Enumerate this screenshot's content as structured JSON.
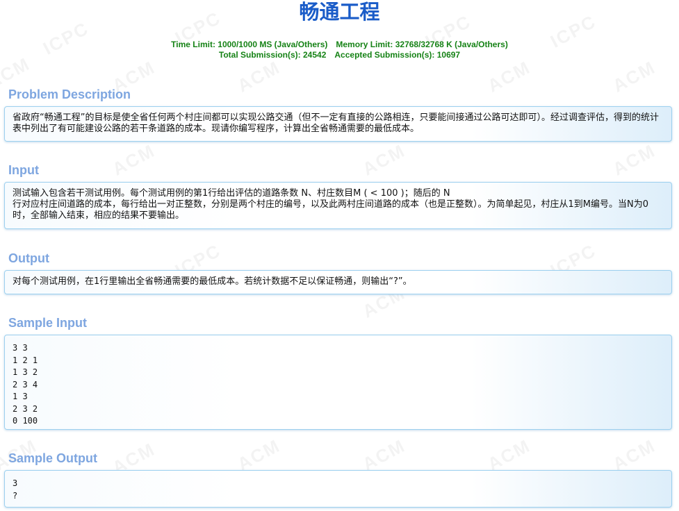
{
  "problem": {
    "title": "畅通工程",
    "time_limit": "Time Limit: 1000/1000 MS (Java/Others)",
    "memory_limit": "Memory Limit: 32768/32768 K (Java/Others)",
    "total_submissions": "Total Submission(s): 24542",
    "accepted_submissions": "Accepted Submission(s): 10697"
  },
  "sections": {
    "description": {
      "heading": "Problem Description",
      "text": "省政府“畅通工程”的目标是使全省任何两个村庄间都可以实现公路交通（但不一定有直接的公路相连，只要能间接通过公路可达即可）。经过调查评估，得到的统计表中列出了有可能建设公路的若干条道路的成本。现请你编写程序，计算出全省畅通需要的最低成本。"
    },
    "input": {
      "heading": "Input",
      "text_line1": "测试输入包含若干测试用例。每个测试用例的第1行给出评估的道路条数 N、村庄数目M ( < 100 )；随后的 N",
      "text_line2": "行对应村庄间道路的成本，每行给出一对正整数，分别是两个村庄的编号，以及此两村庄间道路的成本（也是正整数）。为简单起见，村庄从1到M编号。当N为0时，全部输入结束，相应的结果不要输出。"
    },
    "output": {
      "heading": "Output",
      "text": "对每个测试用例，在1行里输出全省畅通需要的最低成本。若统计数据不足以保证畅通，则输出“?”。"
    },
    "sample_input": {
      "heading": "Sample Input",
      "text": "3 3\n1 2 1\n1 3 2\n2 3 4\n1 3\n2 3 2\n0 100"
    },
    "sample_output": {
      "heading": "Sample Output",
      "text": "3\n?"
    }
  },
  "watermark": {
    "texts": [
      "ACM",
      "ICPC"
    ]
  }
}
